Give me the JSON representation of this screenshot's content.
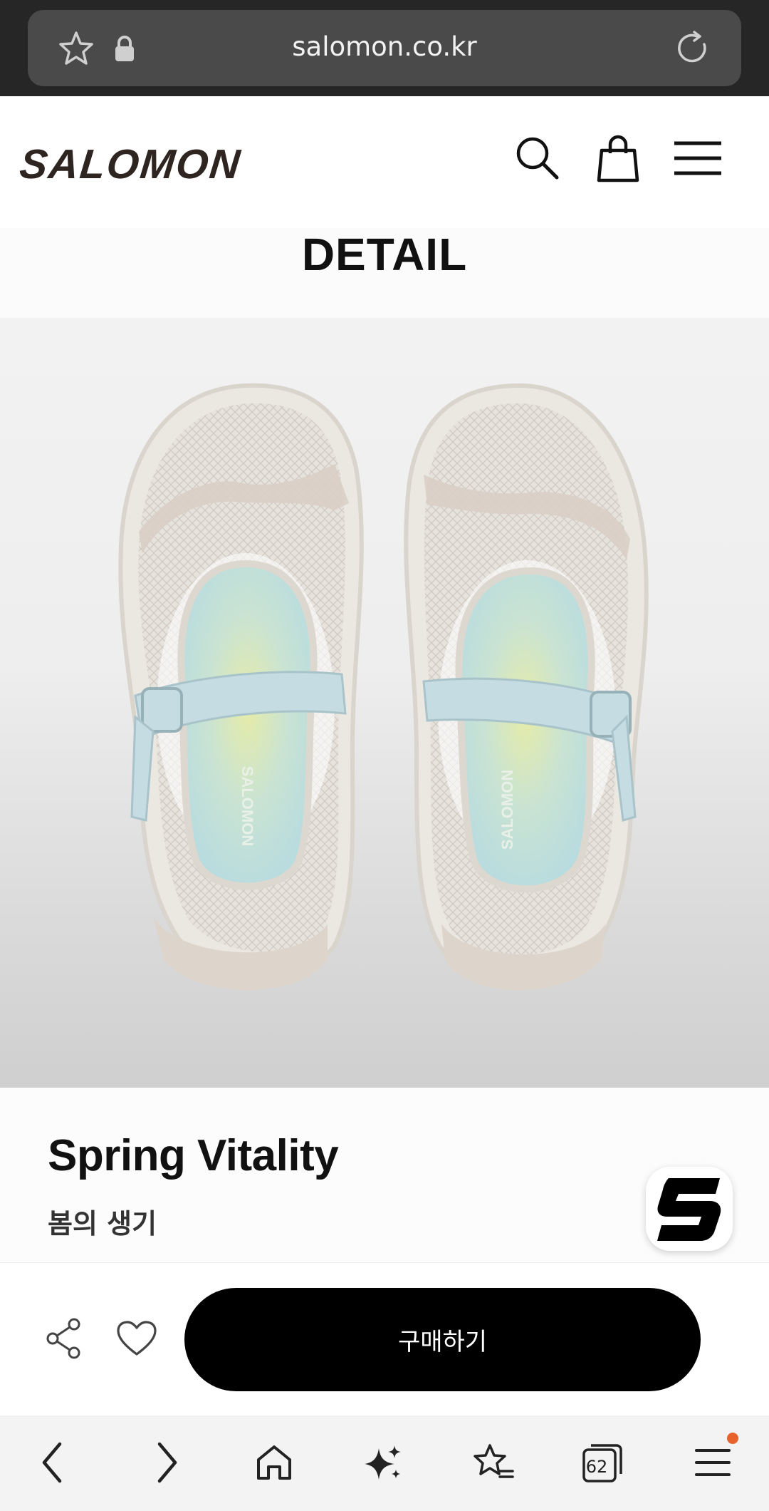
{
  "browser": {
    "url": "salomon.co.kr",
    "tab_count": "62"
  },
  "site": {
    "logo": "SALOMON"
  },
  "page": {
    "section_title": "DETAIL"
  },
  "product": {
    "name": "Spring Vitality",
    "subtitle": "봄의 생기",
    "insole_brand": "SALOMON"
  },
  "purchase": {
    "buy_label": "구매하기"
  },
  "colors": {
    "accent_notification": "#e8632b",
    "buy_button": "#000000",
    "logo": "#2e2420"
  }
}
